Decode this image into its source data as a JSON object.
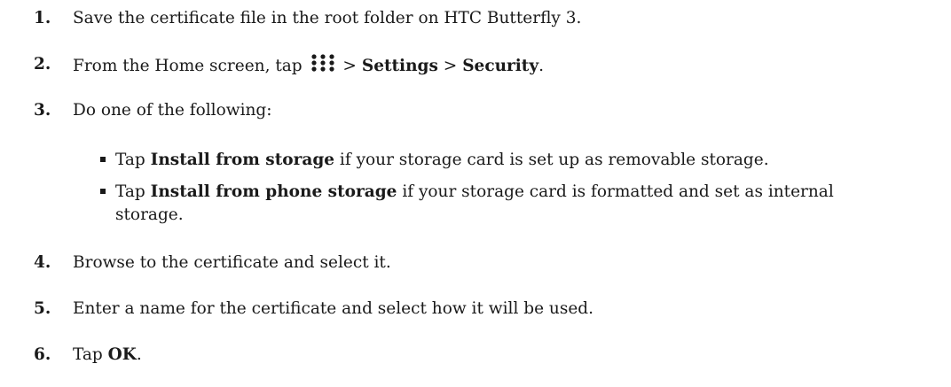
{
  "steps": [
    {
      "num": "1.",
      "text": "Save the certificate file in the root folder on HTC Butterfly 3."
    },
    {
      "num": "2.",
      "pre": "From the Home screen, tap",
      "sep1": ">",
      "b1": "Settings",
      "sep2": ">",
      "b2": "Security",
      "post": "."
    },
    {
      "num": "3.",
      "text": "Do one of the following:"
    },
    {
      "num": "4.",
      "text": "Browse to the certificate and select it."
    },
    {
      "num": "5.",
      "text": "Enter a name for the certificate and select how it will be used."
    },
    {
      "num": "6.",
      "pre": "Tap",
      "b": "OK",
      "post": "."
    }
  ],
  "bullets": [
    {
      "pre": "Tap",
      "b": "Install from storage",
      "post": "if your storage card is set up as removable storage."
    },
    {
      "pre": "Tap",
      "b": "Install from phone storage",
      "post": "if your storage card is formatted and set as internal",
      "post2": "storage."
    }
  ],
  "icons": {
    "apps": "apps-grid-icon"
  }
}
